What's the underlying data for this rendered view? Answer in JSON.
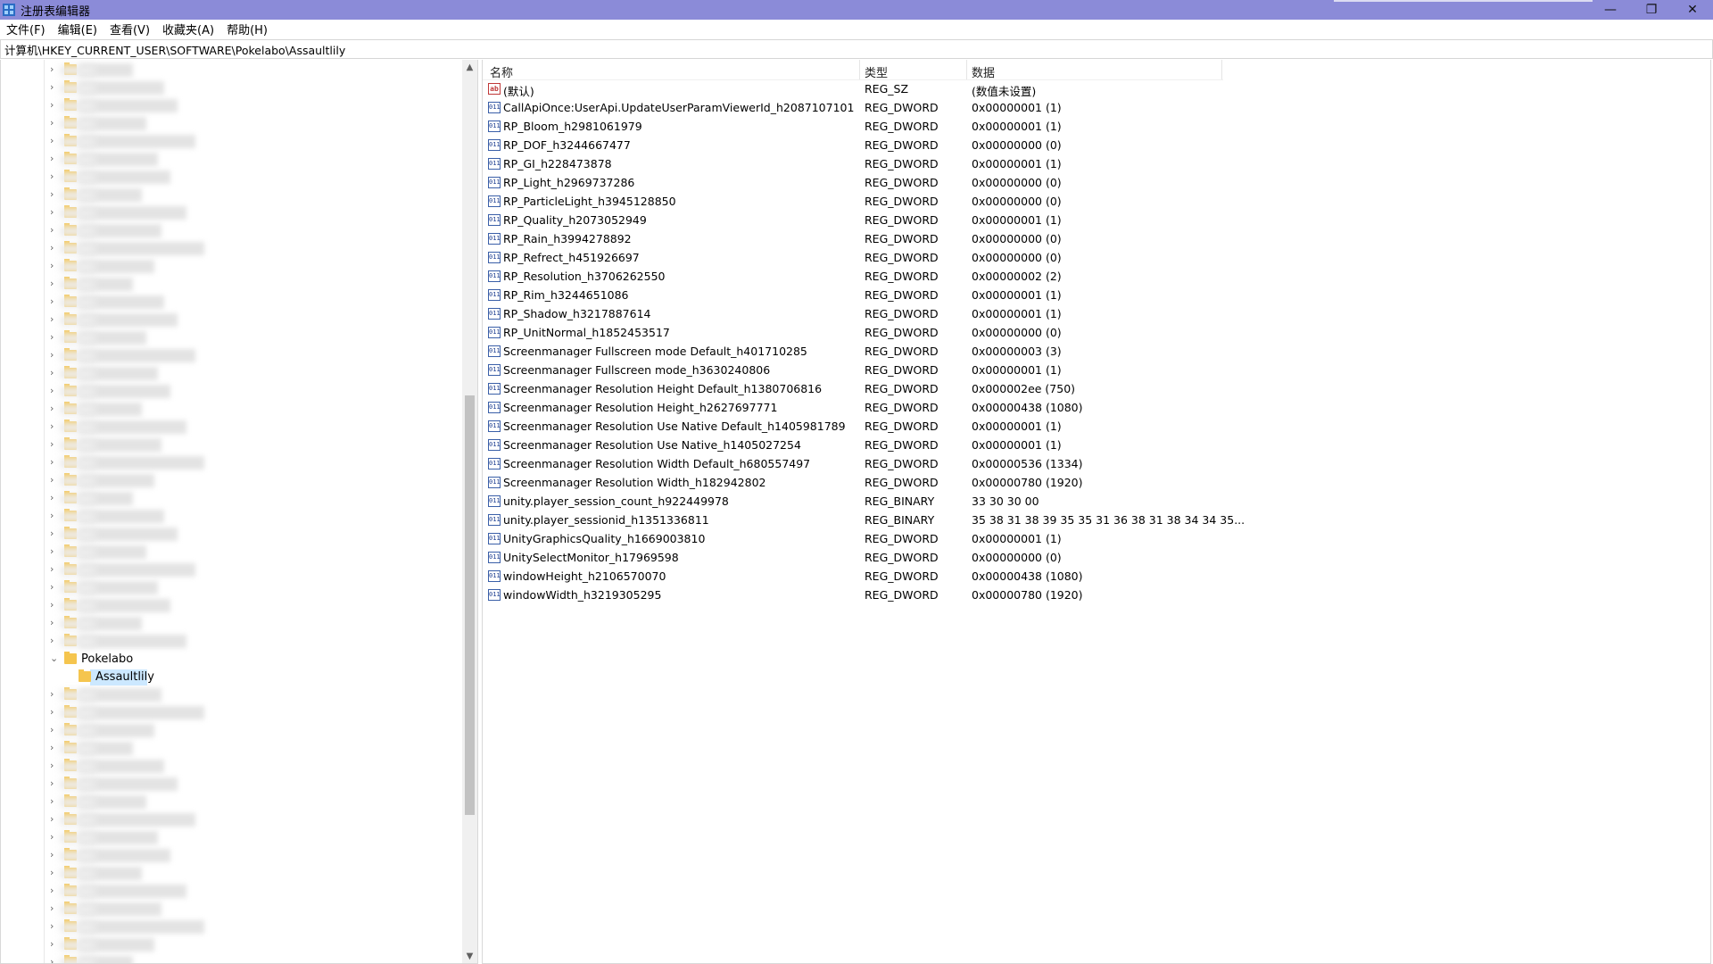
{
  "window": {
    "title": "注册表编辑器",
    "minimize_glyph": "—",
    "restore_glyph": "❐",
    "close_glyph": "✕"
  },
  "menu": [
    "文件(F)",
    "编辑(E)",
    "查看(V)",
    "收藏夹(A)",
    "帮助(H)"
  ],
  "address": "计算机\\HKEY_CURRENT_USER\\SOFTWARE\\Pokelabo\\Assaultlily",
  "tree": {
    "expanded_key": "Pokelabo",
    "selected_key": "Assaultlily",
    "scroll_up": "▲",
    "scroll_down": "▼"
  },
  "list": {
    "headers": {
      "name": "名称",
      "type": "类型",
      "data": "数据"
    },
    "rows": [
      {
        "icon": "string-value-icon",
        "name": "(默认)",
        "type": "REG_SZ",
        "data": "(数值未设置)"
      },
      {
        "icon": "binary-value-icon",
        "name": "CallApiOnce:UserApi.UpdateUserParamViewerId_h2087107101",
        "type": "REG_DWORD",
        "data": "0x00000001 (1)"
      },
      {
        "icon": "binary-value-icon",
        "name": "RP_Bloom_h2981061979",
        "type": "REG_DWORD",
        "data": "0x00000001 (1)"
      },
      {
        "icon": "binary-value-icon",
        "name": "RP_DOF_h3244667477",
        "type": "REG_DWORD",
        "data": "0x00000000 (0)"
      },
      {
        "icon": "binary-value-icon",
        "name": "RP_GI_h228473878",
        "type": "REG_DWORD",
        "data": "0x00000001 (1)"
      },
      {
        "icon": "binary-value-icon",
        "name": "RP_Light_h2969737286",
        "type": "REG_DWORD",
        "data": "0x00000000 (0)"
      },
      {
        "icon": "binary-value-icon",
        "name": "RP_ParticleLight_h3945128850",
        "type": "REG_DWORD",
        "data": "0x00000000 (0)"
      },
      {
        "icon": "binary-value-icon",
        "name": "RP_Quality_h2073052949",
        "type": "REG_DWORD",
        "data": "0x00000001 (1)"
      },
      {
        "icon": "binary-value-icon",
        "name": "RP_Rain_h3994278892",
        "type": "REG_DWORD",
        "data": "0x00000000 (0)"
      },
      {
        "icon": "binary-value-icon",
        "name": "RP_Refrect_h451926697",
        "type": "REG_DWORD",
        "data": "0x00000000 (0)"
      },
      {
        "icon": "binary-value-icon",
        "name": "RP_Resolution_h3706262550",
        "type": "REG_DWORD",
        "data": "0x00000002 (2)"
      },
      {
        "icon": "binary-value-icon",
        "name": "RP_Rim_h3244651086",
        "type": "REG_DWORD",
        "data": "0x00000001 (1)"
      },
      {
        "icon": "binary-value-icon",
        "name": "RP_Shadow_h3217887614",
        "type": "REG_DWORD",
        "data": "0x00000001 (1)"
      },
      {
        "icon": "binary-value-icon",
        "name": "RP_UnitNormal_h1852453517",
        "type": "REG_DWORD",
        "data": "0x00000000 (0)"
      },
      {
        "icon": "binary-value-icon",
        "name": "Screenmanager Fullscreen mode Default_h401710285",
        "type": "REG_DWORD",
        "data": "0x00000003 (3)"
      },
      {
        "icon": "binary-value-icon",
        "name": "Screenmanager Fullscreen mode_h3630240806",
        "type": "REG_DWORD",
        "data": "0x00000001 (1)"
      },
      {
        "icon": "binary-value-icon",
        "name": "Screenmanager Resolution Height Default_h1380706816",
        "type": "REG_DWORD",
        "data": "0x000002ee (750)"
      },
      {
        "icon": "binary-value-icon",
        "name": "Screenmanager Resolution Height_h2627697771",
        "type": "REG_DWORD",
        "data": "0x00000438 (1080)"
      },
      {
        "icon": "binary-value-icon",
        "name": "Screenmanager Resolution Use Native Default_h1405981789",
        "type": "REG_DWORD",
        "data": "0x00000001 (1)"
      },
      {
        "icon": "binary-value-icon",
        "name": "Screenmanager Resolution Use Native_h1405027254",
        "type": "REG_DWORD",
        "data": "0x00000001 (1)"
      },
      {
        "icon": "binary-value-icon",
        "name": "Screenmanager Resolution Width Default_h680557497",
        "type": "REG_DWORD",
        "data": "0x00000536 (1334)"
      },
      {
        "icon": "binary-value-icon",
        "name": "Screenmanager Resolution Width_h182942802",
        "type": "REG_DWORD",
        "data": "0x00000780 (1920)"
      },
      {
        "icon": "binary-value-icon",
        "name": "unity.player_session_count_h922449978",
        "type": "REG_BINARY",
        "data": "33 30 30 00"
      },
      {
        "icon": "binary-value-icon",
        "name": "unity.player_sessionid_h1351336811",
        "type": "REG_BINARY",
        "data": "35 38 31 38 39 35 35 31 36 38 31 38 34 34 35..."
      },
      {
        "icon": "binary-value-icon",
        "name": "UnityGraphicsQuality_h1669003810",
        "type": "REG_DWORD",
        "data": "0x00000001 (1)"
      },
      {
        "icon": "binary-value-icon",
        "name": "UnitySelectMonitor_h17969598",
        "type": "REG_DWORD",
        "data": "0x00000000 (0)"
      },
      {
        "icon": "binary-value-icon",
        "name": "windowHeight_h2106570070",
        "type": "REG_DWORD",
        "data": "0x00000438 (1080)"
      },
      {
        "icon": "binary-value-icon",
        "name": "windowWidth_h3219305295",
        "type": "REG_DWORD",
        "data": "0x00000780 (1920)"
      }
    ]
  }
}
